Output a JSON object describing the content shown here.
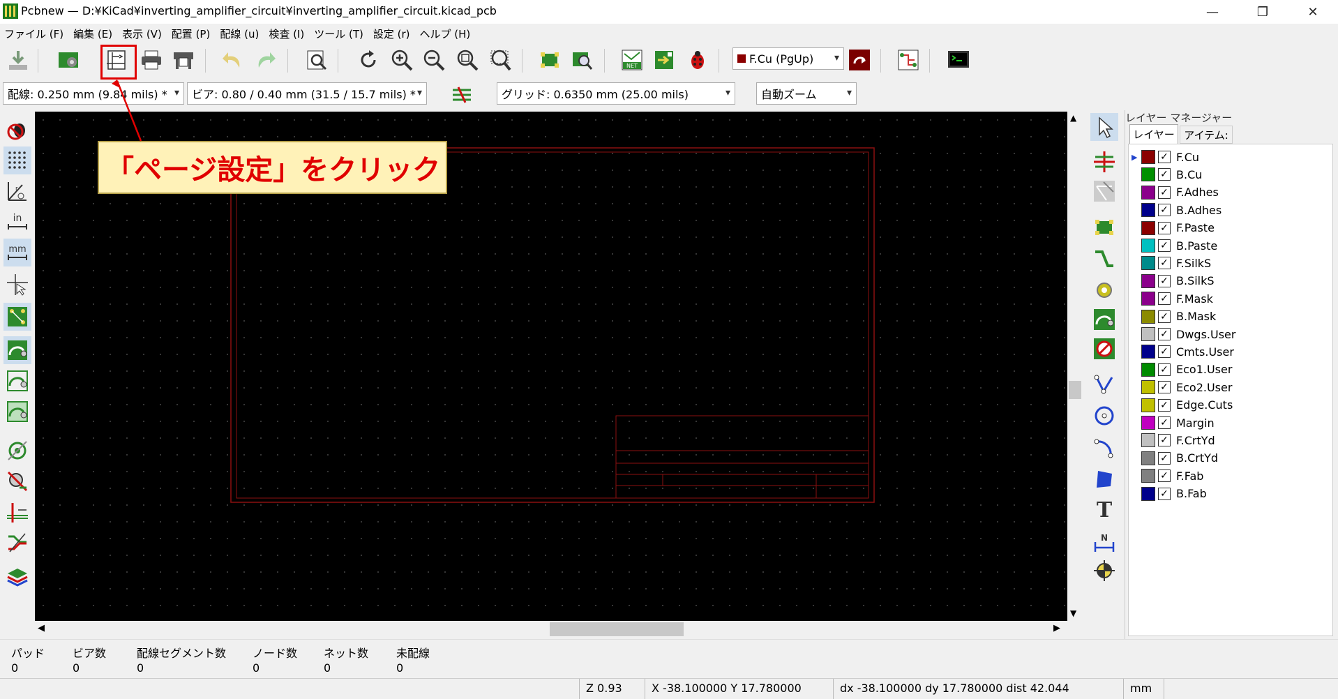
{
  "window": {
    "title": "Pcbnew — D:¥KiCad¥inverting_amplifier_circuit¥inverting_amplifier_circuit.kicad_pcb",
    "minimize": "—",
    "restore": "❐",
    "close": "✕"
  },
  "menu": [
    "ファイル (F)",
    "編集 (E)",
    "表示 (V)",
    "配置 (P)",
    "配線 (u)",
    "検査 (I)",
    "ツール (T)",
    "設定 (r)",
    "ヘルプ (H)"
  ],
  "toolbar": {
    "icons": [
      "save-board-icon",
      "board-setup-icon",
      "page-settings-icon",
      "print-icon",
      "plot-icon",
      "undo-icon",
      "redo-icon",
      "find-icon",
      "redraw-icon",
      "zoom-in-icon",
      "zoom-out-icon",
      "zoom-fit-icon",
      "zoom-selection-icon",
      "footprint-editor-icon",
      "footprint-viewer-icon",
      "netlist-icon",
      "update-pcb-icon",
      "drc-icon",
      "layer-pair-icon",
      "autorouter-icon",
      "scripting-console-icon"
    ],
    "layer_select": "F.Cu (PgUp)",
    "layer_color": "#8b0000"
  },
  "toolbar2": {
    "track_width": "配線: 0.250 mm (9.84 mils) *",
    "via_size": "ビア: 0.80 / 0.40 mm (31.5 / 15.7 mils) *",
    "grid": "グリッド: 0.6350 mm (25.00 mils)",
    "zoom": "自動ズーム"
  },
  "callout": {
    "text": "「ページ設定」をクリック"
  },
  "layer_manager": {
    "title": "レイヤー マネージャー",
    "tabs": [
      "レイヤー",
      "アイテム:"
    ],
    "layers": [
      {
        "name": "F.Cu",
        "color": "#8b0000",
        "checked": true,
        "active": true
      },
      {
        "name": "B.Cu",
        "color": "#009000",
        "checked": true
      },
      {
        "name": "F.Adhes",
        "color": "#8b008b",
        "checked": true
      },
      {
        "name": "B.Adhes",
        "color": "#00008b",
        "checked": true
      },
      {
        "name": "F.Paste",
        "color": "#8b0000",
        "checked": true
      },
      {
        "name": "B.Paste",
        "color": "#00c0c0",
        "checked": true
      },
      {
        "name": "F.SilkS",
        "color": "#008b8b",
        "checked": true
      },
      {
        "name": "B.SilkS",
        "color": "#8b008b",
        "checked": true
      },
      {
        "name": "F.Mask",
        "color": "#8b008b",
        "checked": true
      },
      {
        "name": "B.Mask",
        "color": "#8b8b00",
        "checked": true
      },
      {
        "name": "Dwgs.User",
        "color": "#c0c0c0",
        "checked": true
      },
      {
        "name": "Cmts.User",
        "color": "#00008b",
        "checked": true
      },
      {
        "name": "Eco1.User",
        "color": "#008b00",
        "checked": true
      },
      {
        "name": "Eco2.User",
        "color": "#c0c000",
        "checked": true
      },
      {
        "name": "Edge.Cuts",
        "color": "#c0c000",
        "checked": true
      },
      {
        "name": "Margin",
        "color": "#c000c0",
        "checked": true
      },
      {
        "name": "F.CrtYd",
        "color": "#c0c0c0",
        "checked": true
      },
      {
        "name": "B.CrtYd",
        "color": "#808080",
        "checked": true
      },
      {
        "name": "F.Fab",
        "color": "#808080",
        "checked": true
      },
      {
        "name": "B.Fab",
        "color": "#00008b",
        "checked": true
      }
    ]
  },
  "stats": {
    "headers": [
      "パッド",
      "ビア数",
      "配線セグメント数",
      "ノード数",
      "ネット数",
      "未配線"
    ],
    "values": [
      "0",
      "0",
      "0",
      "0",
      "0",
      "0"
    ]
  },
  "status": {
    "zoom": "Z 0.93",
    "xy": "X -38.100000  Y 17.780000",
    "dxy": "dx -38.100000  dy 17.780000  dist 42.044",
    "units": "mm"
  }
}
